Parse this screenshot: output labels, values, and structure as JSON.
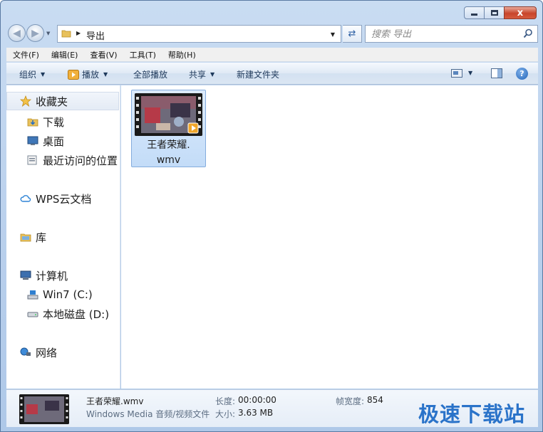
{
  "window": {
    "caption": {
      "minimize": "",
      "maximize": "",
      "close": "x"
    }
  },
  "address": {
    "current_folder": "导出",
    "search_placeholder": "搜索 导出"
  },
  "menu": [
    "文件(F)",
    "编辑(E)",
    "查看(V)",
    "工具(T)",
    "帮助(H)"
  ],
  "toolbar": {
    "organize": "组织",
    "play": "播放",
    "play_all": "全部播放",
    "share": "共享",
    "new_folder": "新建文件夹",
    "help": "?"
  },
  "sidebar": {
    "favorites": "收藏夹",
    "downloads": "下载",
    "desktop": "桌面",
    "recent": "最近访问的位置",
    "wps": "WPS云文档",
    "library": "库",
    "computer": "计算机",
    "drive_c": "Win7 (C:)",
    "drive_d": "本地磁盘 (D:)",
    "network": "网络"
  },
  "files": [
    {
      "name_line1": "王者荣耀.",
      "name_line2": "wmv"
    }
  ],
  "details": {
    "filename": "王者荣耀.wmv",
    "type": "Windows Media 音频/视频文件",
    "length_label": "长度:",
    "length_value": "00:00:00",
    "size_label": "大小:",
    "size_value": "3.63 MB",
    "width_label": "帧宽度:",
    "width_value": "854"
  },
  "watermark": "极速下载站",
  "colors": {
    "accent": "#2a73c9",
    "selection": "#cde4fb",
    "frame": "#b8cfec"
  }
}
